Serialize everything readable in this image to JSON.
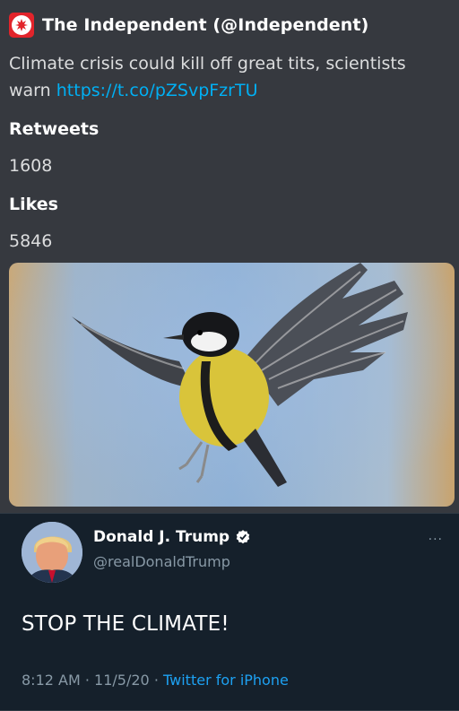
{
  "embed": {
    "author": "The Independent (@Independent)",
    "description_text": "Climate crisis could kill off great tits, scientists warn",
    "description_link": "https://t.co/pZSvpFzrTU",
    "fields": [
      {
        "name": "Retweets",
        "value": "1608"
      },
      {
        "name": "Likes",
        "value": "5846"
      }
    ],
    "image_icon": "great-tit-bird-photo"
  },
  "tweet": {
    "display_name": "Donald J. Trump",
    "handle": "@realDonaldTrump",
    "text": "STOP THE CLIMATE!",
    "time": "8:12 AM",
    "date": "11/5/20",
    "separator": "·",
    "source": "Twitter for iPhone",
    "more_label": "···"
  },
  "colors": {
    "discord_bg": "#36393f",
    "twitter_bg": "#15202b",
    "link_blue": "#00b0f4",
    "twitter_blue": "#1da1f2",
    "independent_red": "#e2242b"
  }
}
